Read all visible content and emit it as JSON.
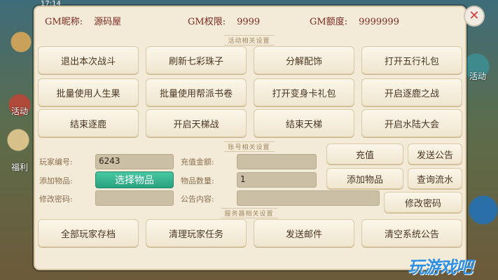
{
  "status_bar": {
    "time": "17:14"
  },
  "side_labels": {
    "left_activity": "活动",
    "left_gift": "福利",
    "right_activity": "活动"
  },
  "gm": {
    "nickname_label": "GM昵称:",
    "nickname_value": "源码屋",
    "permission_label": "GM权限:",
    "permission_value": "9999",
    "quota_label": "GM额度:",
    "quota_value": "9999999"
  },
  "sections": {
    "activity": "活动相关设置",
    "account": "账号相关设置",
    "server": "服务器相关设置"
  },
  "activity_buttons": [
    "退出本次战斗",
    "刷新七彩珠子",
    "分解配饰",
    "打开五行礼包",
    "批量使用人生果",
    "批量使用帮派书卷",
    "打开变身卡礼包",
    "开启逐鹿之战",
    "结束逐鹿",
    "开启天梯战",
    "结束天梯",
    "开启水陆大会"
  ],
  "account": {
    "player_id_label": "玩家编号:",
    "player_id_value": "6243",
    "recharge_amount_label": "充值金额:",
    "recharge_amount_value": "",
    "add_item_label": "添加物品:",
    "select_item_button": "选择物品",
    "item_quantity_label": "物品数量:",
    "item_quantity_value": "1",
    "change_password_label": "修改密码:",
    "password_value": "",
    "announcement_label": "公告内容:",
    "announcement_value": "",
    "recharge_button": "充值",
    "send_announcement_button": "发送公告",
    "add_item_button": "添加物品",
    "query_flow_button": "查询流水",
    "change_password_button": "修改密码"
  },
  "server_buttons": [
    "全部玩家存档",
    "清理玩家任务",
    "发送邮件",
    "清空系统公告"
  ],
  "watermark": "玩游戏吧"
}
